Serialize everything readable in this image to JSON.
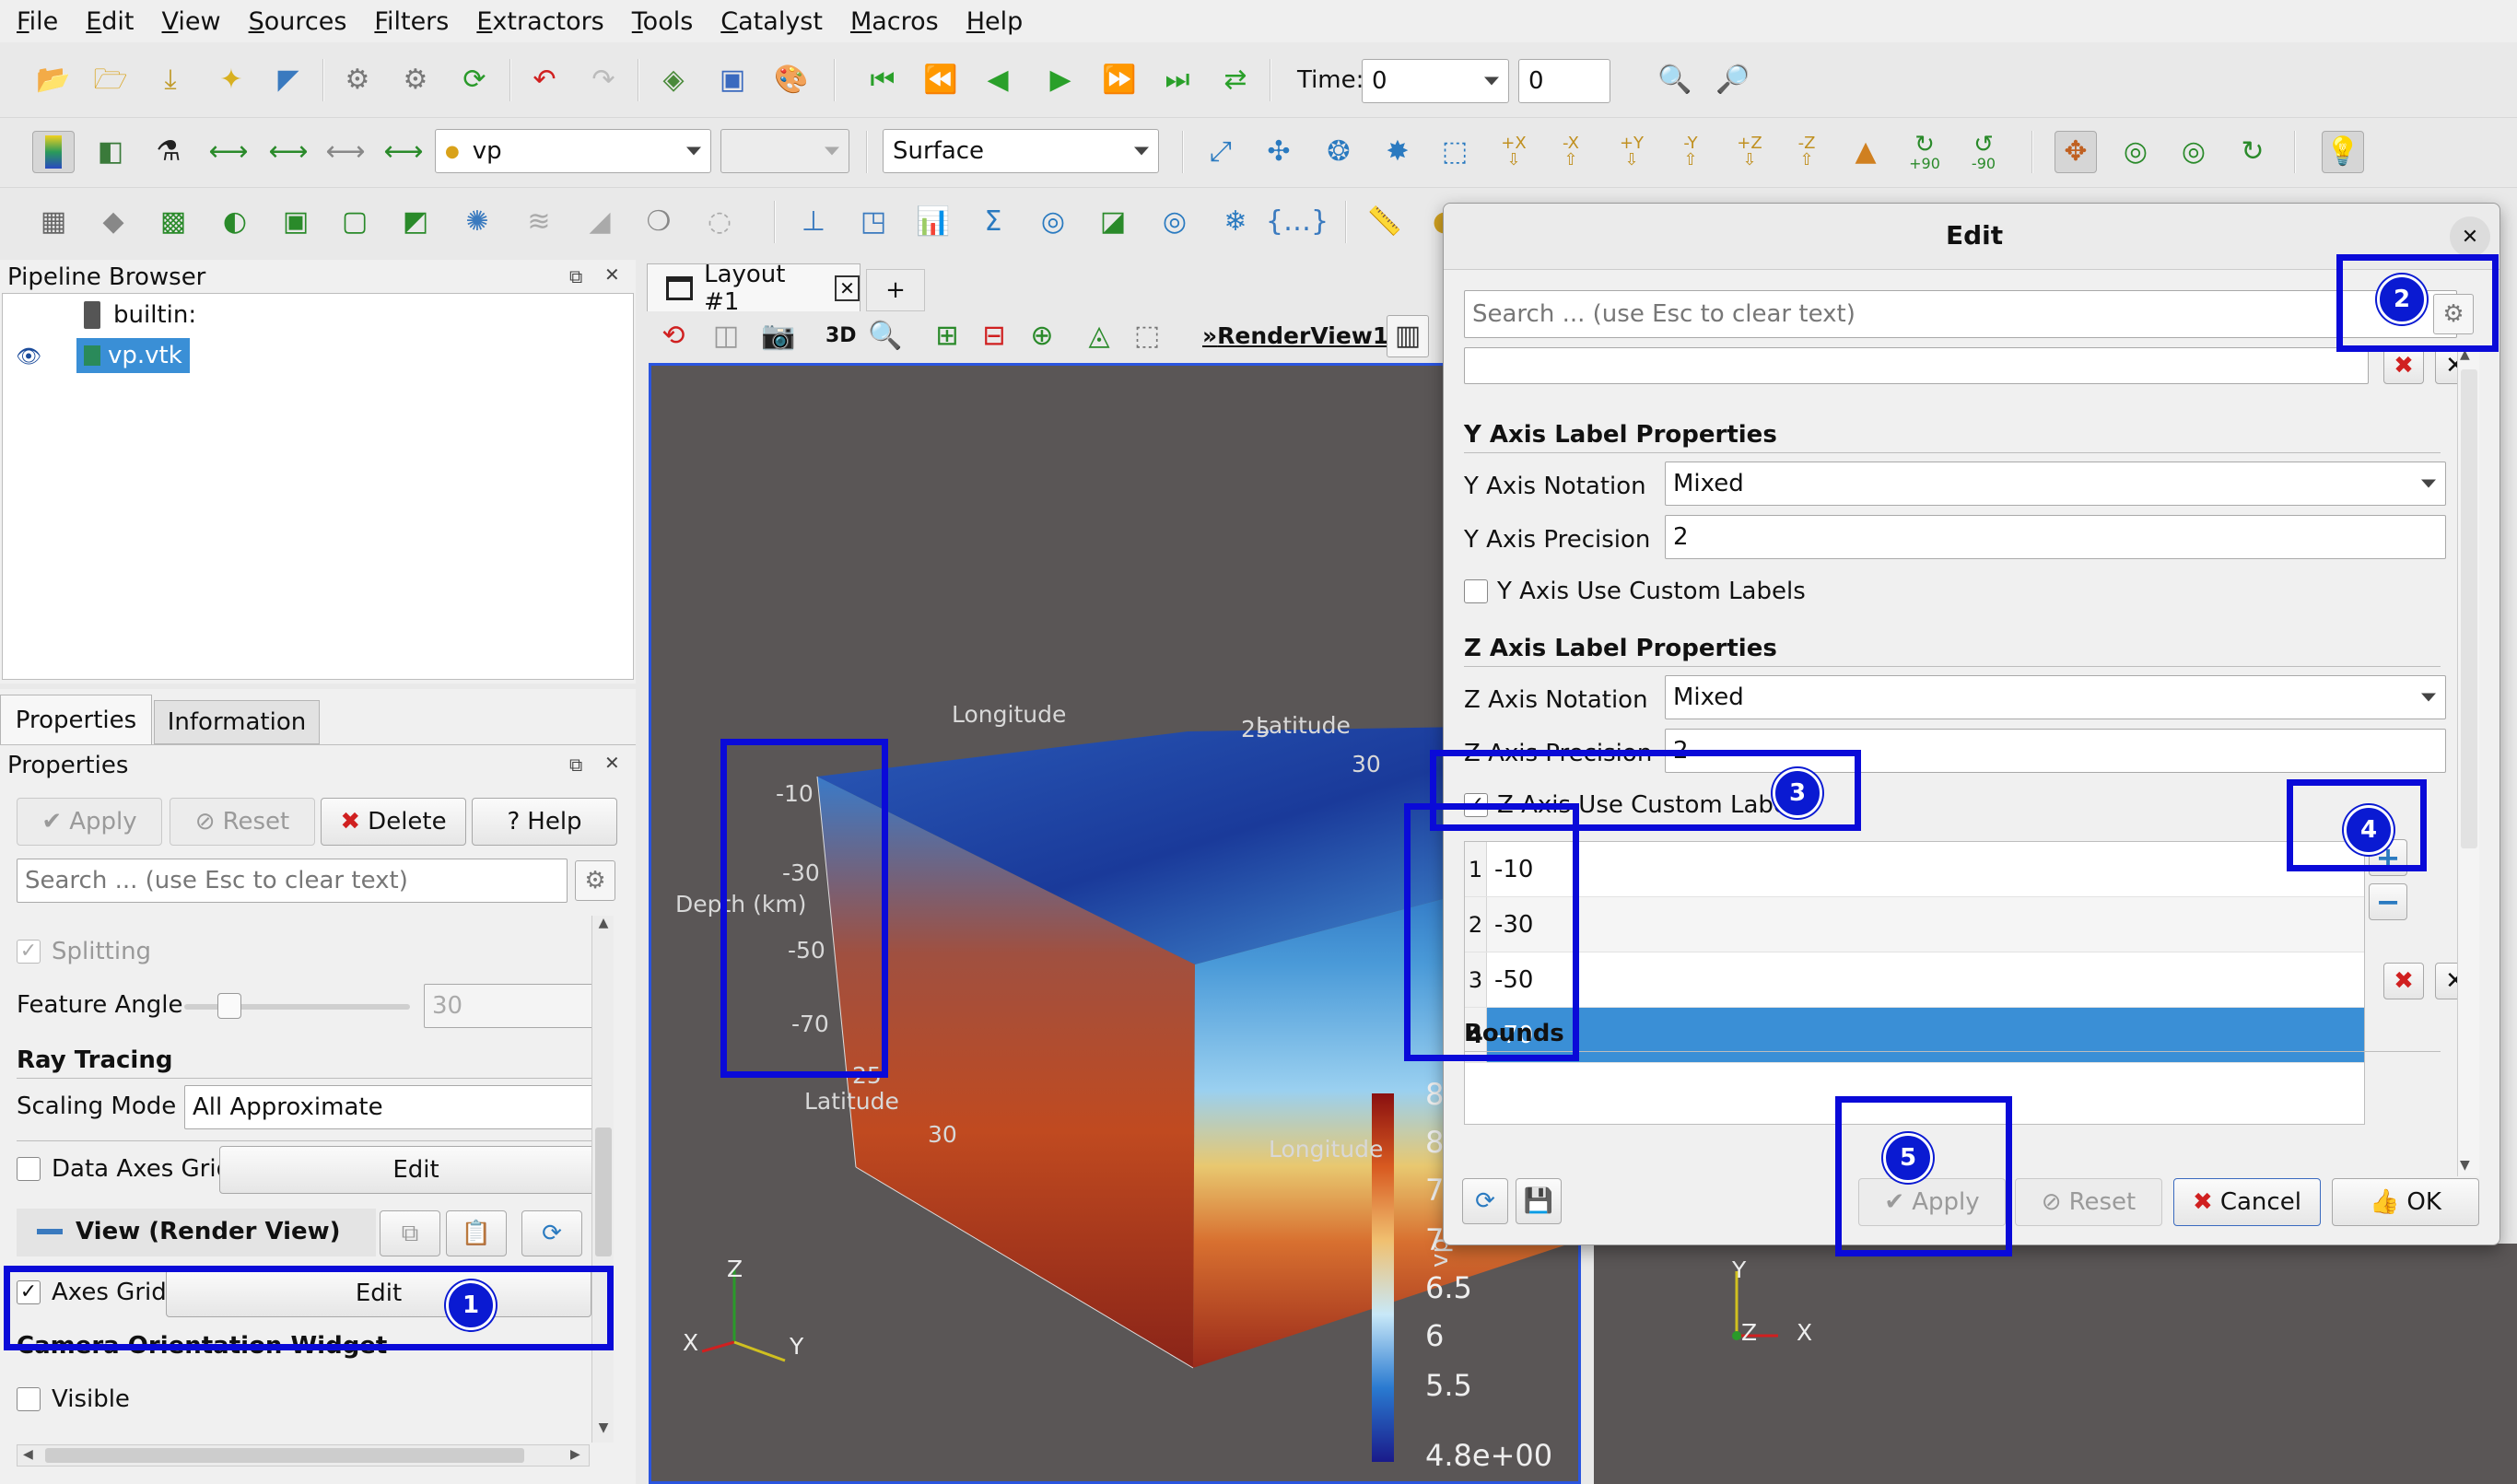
{
  "menubar": [
    "File",
    "Edit",
    "View",
    "Sources",
    "Filters",
    "Extractors",
    "Tools",
    "Catalyst",
    "Macros",
    "Help"
  ],
  "toolbar1": {
    "time_label": "Time:",
    "time_value": "0",
    "timestep_value": "0"
  },
  "toolbar2": {
    "source_combo": "vp",
    "representation_combo": "Surface",
    "rotate_labels": [
      "+90",
      "-90"
    ],
    "axis_labels": [
      "+X",
      "-X",
      "+Y",
      "-Y",
      "+Z",
      "-Z"
    ]
  },
  "pipeline": {
    "title": "Pipeline Browser",
    "items": [
      "builtin:",
      "vp.vtk"
    ]
  },
  "tabs": {
    "properties": "Properties",
    "information": "Information"
  },
  "properties": {
    "title": "Properties",
    "apply": "Apply",
    "reset": "Reset",
    "delete": "Delete",
    "help": "Help",
    "search_placeholder": "Search ... (use Esc to clear text)",
    "splitting": "Splitting",
    "feature_angle_label": "Feature Angle",
    "feature_angle_value": "30",
    "ray_tracing": "Ray Tracing",
    "scaling_mode_label": "Scaling Mode",
    "scaling_mode_value": "All Approximate",
    "data_axes_grid": "Data Axes Grid",
    "edit": "Edit",
    "view_section": "View (Render View)",
    "axes_grid": "Axes Grid",
    "camera_widget": "Camera Orientation Widget",
    "visible": "Visible"
  },
  "layout": {
    "tab": "Layout #1",
    "add": "+",
    "mode_3d": "3D",
    "view_name": "RenderView1"
  },
  "render": {
    "longitude_top": "Longitude",
    "latitude_top": "Latitude",
    "lat_tick_top": "25",
    "lon_tick_30": "30",
    "depth_label": "Depth (km)",
    "z_ticks": [
      "-10",
      "-30",
      "-50",
      "-70"
    ],
    "lat_tick_bottom": "25",
    "latitude_bottom": "Latitude",
    "lat_30_bottom": "30",
    "longitude_bottom": "Longitude",
    "axes": {
      "z": "Z",
      "x": "X",
      "y": "Y"
    }
  },
  "colorbar": {
    "title": "vp",
    "ticks": [
      "8",
      "8",
      "7.",
      "7",
      "6.5",
      "6",
      "5.5",
      "4.8e+00"
    ]
  },
  "dialog": {
    "title": "Edit",
    "close": "✕",
    "search_placeholder": "Search ... (use Esc to clear text)",
    "y_section": "Y Axis Label Properties",
    "y_notation_label": "Y Axis Notation",
    "y_notation_value": "Mixed",
    "y_precision_label": "Y Axis Precision",
    "y_precision_value": "2",
    "y_custom": "Y Axis Use Custom Labels",
    "z_section": "Z Axis Label Properties",
    "z_notation_label": "Z Axis Notation",
    "z_notation_value": "Mixed",
    "z_precision_label": "Z Axis Precision",
    "z_precision_value": "2",
    "z_custom": "Z Axis Use Custom Labels",
    "custom_rows": [
      {
        "n": "1",
        "v": "-10"
      },
      {
        "n": "2",
        "v": "-30"
      },
      {
        "n": "3",
        "v": "-50"
      },
      {
        "n": "4",
        "v": "-70"
      }
    ],
    "bounds": "Bounds",
    "apply": "Apply",
    "reset": "Reset",
    "cancel": "Cancel",
    "ok": "OK"
  },
  "right_axes": {
    "y": "Y",
    "z": "Z",
    "x": "X"
  },
  "badges": [
    "1",
    "2",
    "3",
    "4",
    "5"
  ],
  "colors": {
    "highlight": "#0a0ad8",
    "badge": "#0a1ad2",
    "selection": "#3a8fd6",
    "render_bg": "#5a5656"
  }
}
